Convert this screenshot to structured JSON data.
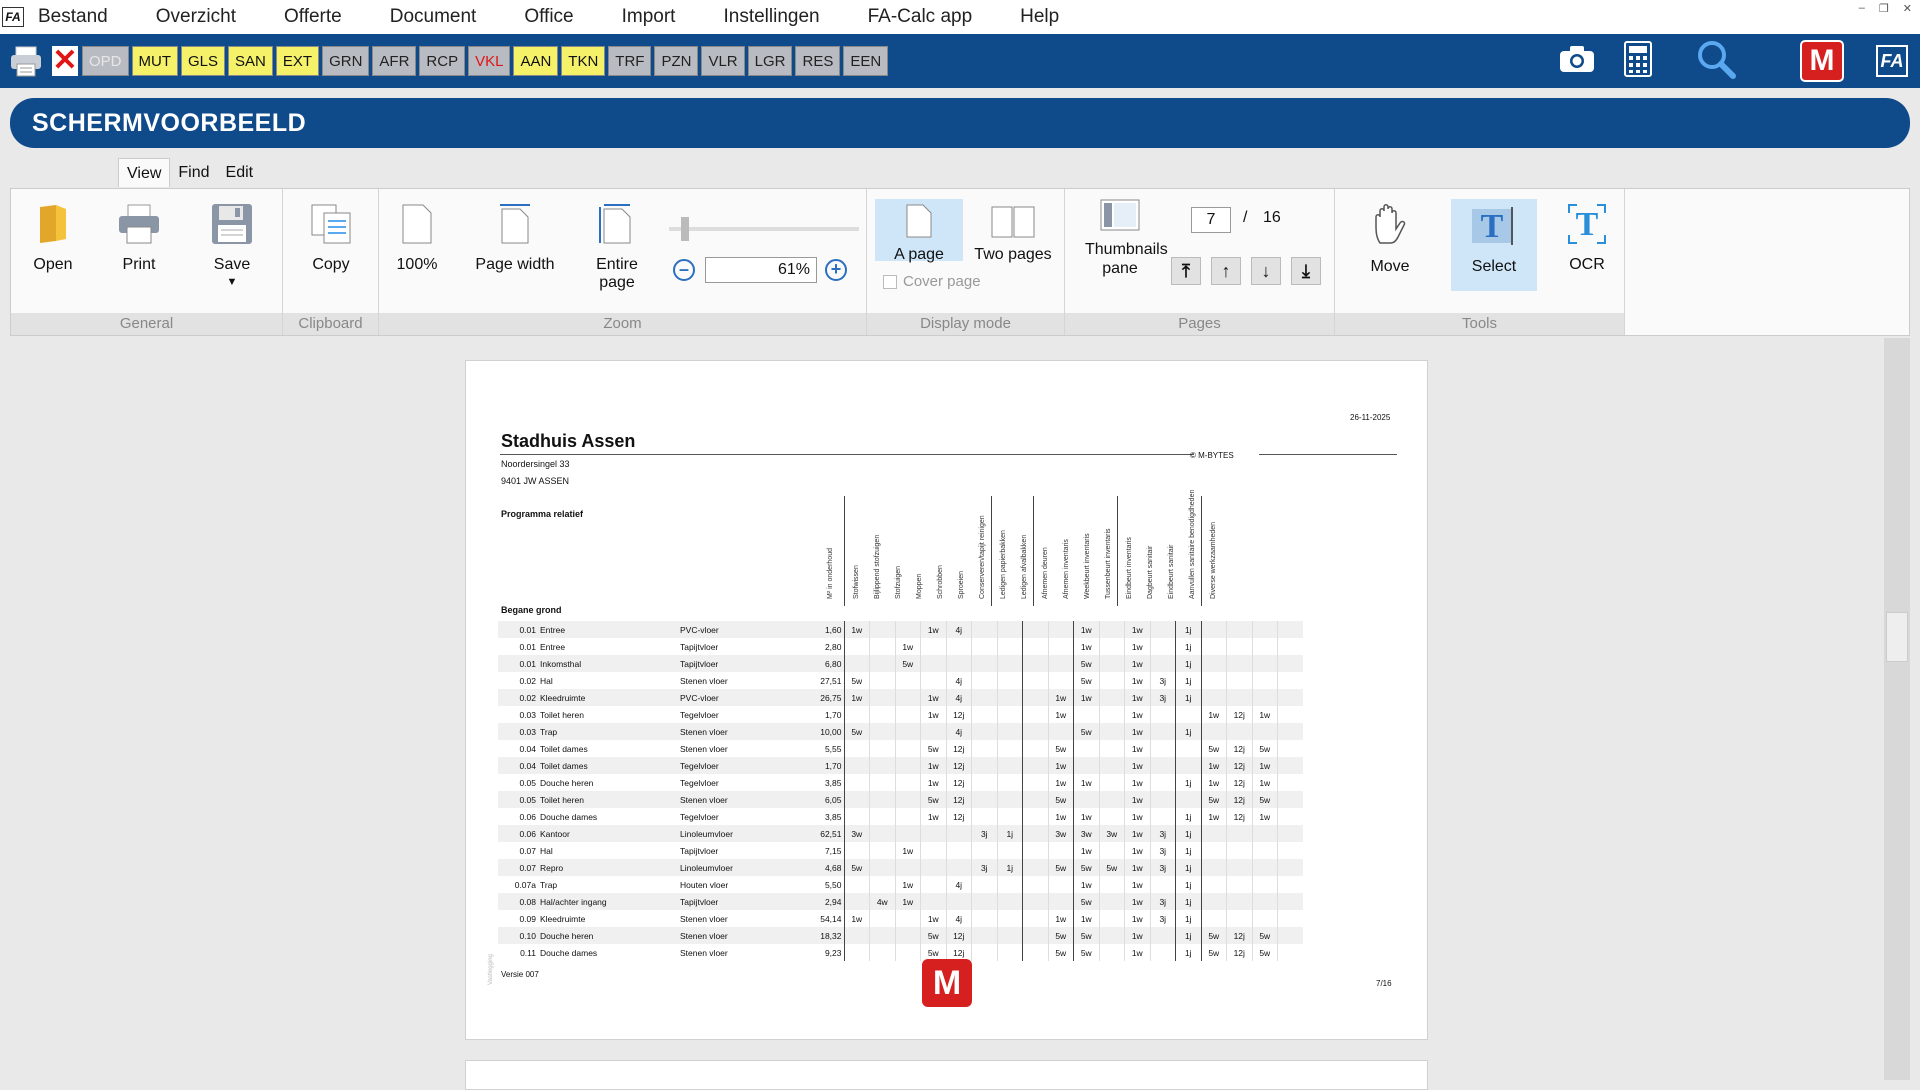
{
  "menu": {
    "items": [
      "Bestand",
      "Overzicht",
      "Offerte",
      "Document",
      "Office",
      "Import",
      "Instellingen",
      "FA-Calc app",
      "Help"
    ]
  },
  "window_controls": [
    "–",
    "❐",
    "✕"
  ],
  "app_logo": "FA",
  "toolbar": {
    "tabs": [
      {
        "label": "OPD",
        "style": "dim"
      },
      {
        "label": "MUT",
        "style": "yellow"
      },
      {
        "label": "GLS",
        "style": "yellow"
      },
      {
        "label": "SAN",
        "style": "yellow"
      },
      {
        "label": "EXT",
        "style": "yellow"
      },
      {
        "label": "GRN",
        "style": "gray"
      },
      {
        "label": "AFR",
        "style": "gray"
      },
      {
        "label": "RCP",
        "style": "gray"
      },
      {
        "label": "VKL",
        "style": "red"
      },
      {
        "label": "AAN",
        "style": "yellow"
      },
      {
        "label": "TKN",
        "style": "yellow"
      },
      {
        "label": "TRF",
        "style": "gray"
      },
      {
        "label": "PZN",
        "style": "gray"
      },
      {
        "label": "VLR",
        "style": "gray"
      },
      {
        "label": "LGR",
        "style": "gray"
      },
      {
        "label": "RES",
        "style": "gray"
      },
      {
        "label": "EEN",
        "style": "gray"
      }
    ],
    "right_icons": [
      "camera-icon",
      "calculator-icon",
      "search-icon",
      "m-bytes-logo",
      "fa-calc-icon"
    ],
    "m_logo": "M",
    "fa_logo": "FA"
  },
  "header": {
    "title": "SCHERMVOORBEELD"
  },
  "ribbon": {
    "tabs": [
      "View",
      "Find",
      "Edit"
    ],
    "active_tab": "View",
    "groups": {
      "general": {
        "label": "General",
        "open": "Open",
        "print": "Print",
        "save": "Save"
      },
      "clipboard": {
        "label": "Clipboard",
        "copy": "Copy"
      },
      "zoom": {
        "label": "Zoom",
        "z100": "100%",
        "page_width": "Page width",
        "entire_page": "Entire page",
        "value": "61%",
        "minus": "–",
        "plus": "+"
      },
      "display": {
        "label": "Display mode",
        "a_page": "A page",
        "two_pages": "Two pages",
        "cover_page": "Cover page"
      },
      "pages": {
        "label": "Pages",
        "thumbnails": "Thumbnails pane",
        "current": "7",
        "sep": "/",
        "total": "16"
      },
      "tools": {
        "label": "Tools",
        "move": "Move",
        "select": "Select",
        "ocr": "OCR"
      }
    }
  },
  "document": {
    "date": "26-11-2025",
    "name": "Stadhuis Assen",
    "address1": "Noordersingel 33",
    "address2": "9401 JW ASSEN",
    "copyright": "© M-BYTES",
    "program": "Programma relatief",
    "section": "Begane grond",
    "version": "Versie 007",
    "page_no": "7/16",
    "side_text": "Vastlegging",
    "m_logo": "M",
    "col_m2": "M² in onderhoud",
    "columns": [
      "Stofwissen",
      "Bijlippend stofzuigen",
      "Stofzuigen",
      "Moppen",
      "Schrobben",
      "Sproeien",
      "Conserveren/tapijt reinigen",
      "Ledigen papierbakken",
      "Ledigen afvalbakken",
      "Afnemen deuren",
      "Afnemen inventaris",
      "Weekbeurt inventaris",
      "Tussenbeurt inventaris",
      "Eindbeurt inventaris",
      "Dagbeurt sanitair",
      "Eindbeurt sanitair",
      "Aanvullen sanitaire benodigdheden",
      "Diverse werkzaamheden"
    ],
    "rows": [
      {
        "nr": "0.01",
        "room": "Entree",
        "floor": "PVC-vloer",
        "m2": "1,60",
        "v": [
          "1w",
          "",
          "",
          "1w",
          "4j",
          "",
          "",
          "",
          "",
          "1w",
          "",
          "1w",
          "",
          "1j",
          "",
          "",
          "",
          ""
        ]
      },
      {
        "nr": "0.01",
        "room": "Entree",
        "floor": "Tapijtvloer",
        "m2": "2,80",
        "v": [
          "",
          "",
          "1w",
          "",
          "",
          "",
          "",
          "",
          "",
          "1w",
          "",
          "1w",
          "",
          "1j",
          "",
          "",
          "",
          ""
        ]
      },
      {
        "nr": "0.01",
        "room": "Inkomsthal",
        "floor": "Tapijtvloer",
        "m2": "6,80",
        "v": [
          "",
          "",
          "5w",
          "",
          "",
          "",
          "",
          "",
          "",
          "5w",
          "",
          "1w",
          "",
          "1j",
          "",
          "",
          "",
          ""
        ]
      },
      {
        "nr": "0.02",
        "room": "Hal",
        "floor": "Stenen vloer",
        "m2": "27,51",
        "v": [
          "5w",
          "",
          "",
          "",
          "4j",
          "",
          "",
          "",
          "",
          "5w",
          "",
          "1w",
          "3j",
          "1j",
          "",
          "",
          "",
          ""
        ]
      },
      {
        "nr": "0.02",
        "room": "Kleedruimte",
        "floor": "PVC-vloer",
        "m2": "26,75",
        "v": [
          "1w",
          "",
          "",
          "1w",
          "4j",
          "",
          "",
          "",
          "1w",
          "1w",
          "",
          "1w",
          "3j",
          "1j",
          "",
          "",
          "",
          ""
        ]
      },
      {
        "nr": "0.03",
        "room": "Toilet heren",
        "floor": "Tegelvloer",
        "m2": "1,70",
        "v": [
          "",
          "",
          "",
          "1w",
          "12j",
          "",
          "",
          "",
          "1w",
          "",
          "",
          "1w",
          "",
          "",
          "1w",
          "12j",
          "1w",
          ""
        ]
      },
      {
        "nr": "0.03",
        "room": "Trap",
        "floor": "Stenen vloer",
        "m2": "10,00",
        "v": [
          "5w",
          "",
          "",
          "",
          "4j",
          "",
          "",
          "",
          "",
          "5w",
          "",
          "1w",
          "",
          "1j",
          "",
          "",
          "",
          ""
        ]
      },
      {
        "nr": "0.04",
        "room": "Toilet dames",
        "floor": "Stenen vloer",
        "m2": "5,55",
        "v": [
          "",
          "",
          "",
          "5w",
          "12j",
          "",
          "",
          "",
          "5w",
          "",
          "",
          "1w",
          "",
          "",
          "5w",
          "12j",
          "5w",
          ""
        ]
      },
      {
        "nr": "0.04",
        "room": "Toilet dames",
        "floor": "Tegelvloer",
        "m2": "1,70",
        "v": [
          "",
          "",
          "",
          "1w",
          "12j",
          "",
          "",
          "",
          "1w",
          "",
          "",
          "1w",
          "",
          "",
          "1w",
          "12j",
          "1w",
          ""
        ]
      },
      {
        "nr": "0.05",
        "room": "Douche heren",
        "floor": "Tegelvloer",
        "m2": "3,85",
        "v": [
          "",
          "",
          "",
          "1w",
          "12j",
          "",
          "",
          "",
          "1w",
          "1w",
          "",
          "1w",
          "",
          "1j",
          "1w",
          "12j",
          "1w",
          ""
        ]
      },
      {
        "nr": "0.05",
        "room": "Toilet heren",
        "floor": "Stenen vloer",
        "m2": "6,05",
        "v": [
          "",
          "",
          "",
          "5w",
          "12j",
          "",
          "",
          "",
          "5w",
          "",
          "",
          "1w",
          "",
          "",
          "5w",
          "12j",
          "5w",
          ""
        ]
      },
      {
        "nr": "0.06",
        "room": "Douche dames",
        "floor": "Tegelvloer",
        "m2": "3,85",
        "v": [
          "",
          "",
          "",
          "1w",
          "12j",
          "",
          "",
          "",
          "1w",
          "1w",
          "",
          "1w",
          "",
          "1j",
          "1w",
          "12j",
          "1w",
          ""
        ]
      },
      {
        "nr": "0.06",
        "room": "Kantoor",
        "floor": "Linoleumvloer",
        "m2": "62,51",
        "v": [
          "3w",
          "",
          "",
          "",
          "",
          "3j",
          "1j",
          "",
          "3w",
          "3w",
          "3w",
          "1w",
          "3j",
          "1j",
          "",
          "",
          "",
          ""
        ]
      },
      {
        "nr": "0.07",
        "room": "Hal",
        "floor": "Tapijtvloer",
        "m2": "7,15",
        "v": [
          "",
          "",
          "1w",
          "",
          "",
          "",
          "",
          "",
          "",
          "1w",
          "",
          "1w",
          "3j",
          "1j",
          "",
          "",
          "",
          ""
        ]
      },
      {
        "nr": "0.07",
        "room": "Repro",
        "floor": "Linoleumvloer",
        "m2": "4,68",
        "v": [
          "5w",
          "",
          "",
          "",
          "",
          "3j",
          "1j",
          "",
          "5w",
          "5w",
          "5w",
          "1w",
          "3j",
          "1j",
          "",
          "",
          "",
          ""
        ]
      },
      {
        "nr": "0.07a",
        "room": "Trap",
        "floor": "Houten vloer",
        "m2": "5,50",
        "v": [
          "",
          "",
          "1w",
          "",
          "4j",
          "",
          "",
          "",
          "",
          "1w",
          "",
          "1w",
          "",
          "1j",
          "",
          "",
          "",
          ""
        ]
      },
      {
        "nr": "0.08",
        "room": "Hal/achter ingang",
        "floor": "Tapijtvloer",
        "m2": "2,94",
        "v": [
          "",
          "4w",
          "1w",
          "",
          "",
          "",
          "",
          "",
          "",
          "5w",
          "",
          "1w",
          "3j",
          "1j",
          "",
          "",
          "",
          ""
        ]
      },
      {
        "nr": "0.09",
        "room": "Kleedruimte",
        "floor": "Stenen vloer",
        "m2": "54,14",
        "v": [
          "1w",
          "",
          "",
          "1w",
          "4j",
          "",
          "",
          "",
          "1w",
          "1w",
          "",
          "1w",
          "3j",
          "1j",
          "",
          "",
          "",
          ""
        ]
      },
      {
        "nr": "0.10",
        "room": "Douche heren",
        "floor": "Stenen vloer",
        "m2": "18,32",
        "v": [
          "",
          "",
          "",
          "5w",
          "12j",
          "",
          "",
          "",
          "5w",
          "5w",
          "",
          "1w",
          "",
          "1j",
          "5w",
          "12j",
          "5w",
          ""
        ]
      },
      {
        "nr": "0.11",
        "room": "Douche dames",
        "floor": "Stenen vloer",
        "m2": "9,23",
        "v": [
          "",
          "",
          "",
          "5w",
          "12j",
          "",
          "",
          "",
          "5w",
          "5w",
          "",
          "1w",
          "",
          "1j",
          "5w",
          "12j",
          "5w",
          ""
        ]
      }
    ]
  },
  "colors": {
    "brand_blue": "#0f4a8a",
    "tab_yellow": "#f5f26a",
    "tab_gray": "#b8bcc2",
    "logo_red": "#d62020",
    "select_bg": "#cfe6f8"
  }
}
